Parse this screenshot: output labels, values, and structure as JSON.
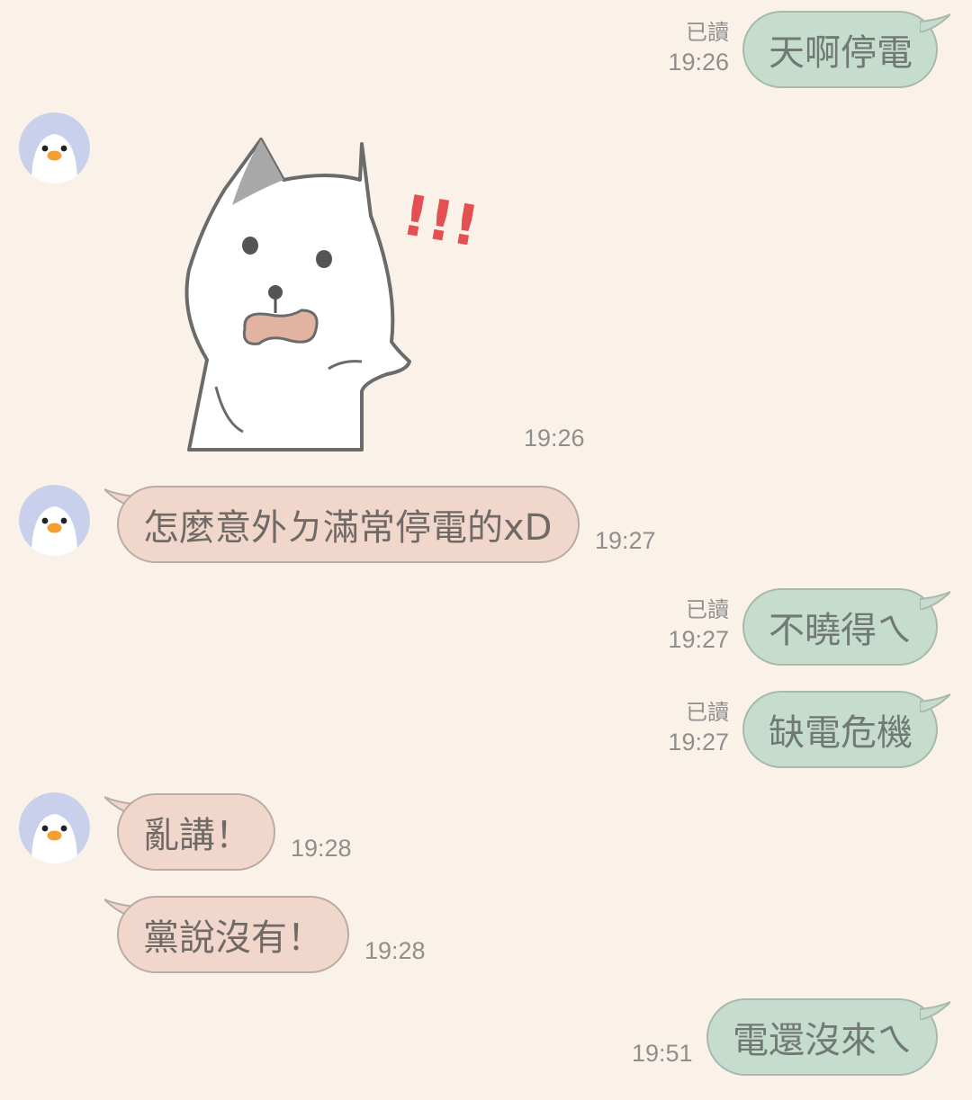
{
  "messages": [
    {
      "id": "m1",
      "side": "out",
      "text": "天啊停電",
      "read": "已讀",
      "time": "19:26"
    },
    {
      "id": "m2",
      "side": "in",
      "type": "sticker",
      "time": "19:26"
    },
    {
      "id": "m3",
      "side": "in",
      "text": "怎麼意外ㄉ滿常停電的xD",
      "time": "19:27"
    },
    {
      "id": "m4",
      "side": "out",
      "text": "不曉得ㄟ",
      "read": "已讀",
      "time": "19:27"
    },
    {
      "id": "m5",
      "side": "out",
      "text": "缺電危機",
      "read": "已讀",
      "time": "19:27"
    },
    {
      "id": "m6",
      "side": "in",
      "text": "亂講！",
      "time": "19:28"
    },
    {
      "id": "m7",
      "side": "in",
      "text": "黨說沒有！",
      "time": "19:28"
    },
    {
      "id": "m8",
      "side": "out",
      "text": "電還沒來ㄟ",
      "time": "19:51"
    }
  ],
  "sticker": {
    "exclamation": "!!!"
  },
  "colors": {
    "background": "#faf1e8",
    "outgoing_bubble": "#c5dccf",
    "incoming_bubble": "#f1d7cb",
    "avatar_bg": "#c9d0ec"
  },
  "icons": {
    "avatar": "penguin-avatar-icon",
    "sticker": "cat-surprised-sticker"
  }
}
